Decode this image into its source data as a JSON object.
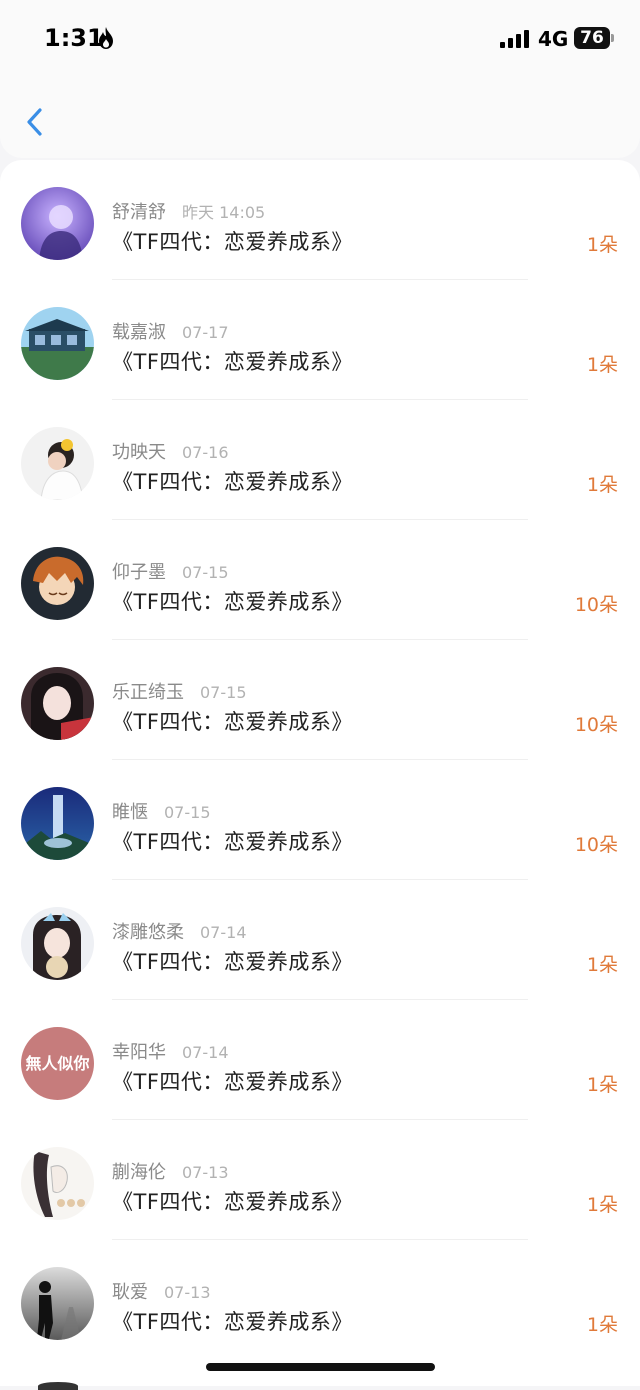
{
  "status": {
    "time": "1:31",
    "network": "4G",
    "battery": "76"
  },
  "nav": {
    "back_icon": "chevron-left-icon"
  },
  "colors": {
    "accent": "#e07a3a",
    "back": "#3a8ee6",
    "username": "#8a8a8a",
    "timestamp": "#b2b2b2"
  },
  "records": [
    {
      "name": "舒清舒",
      "time": "昨天 14:05",
      "title": "《TF四代：恋爱养成系》",
      "amount": "1朵",
      "avatar": "purple-portrait"
    },
    {
      "name": "载嘉淑",
      "time": "07-17",
      "title": "《TF四代：恋爱养成系》",
      "amount": "1朵",
      "avatar": "house-scene"
    },
    {
      "name": "功映天",
      "time": "07-16",
      "title": "《TF四代：恋爱养成系》",
      "amount": "1朵",
      "avatar": "girl-flower"
    },
    {
      "name": "仰子墨",
      "time": "07-15",
      "title": "《TF四代：恋爱养成系》",
      "amount": "10朵",
      "avatar": "anime-boy"
    },
    {
      "name": "乐正绮玉",
      "time": "07-15",
      "title": "《TF四代：恋爱养成系》",
      "amount": "10朵",
      "avatar": "girl-red"
    },
    {
      "name": "睢惬",
      "time": "07-15",
      "title": "《TF四代：恋爱养成系》",
      "amount": "10朵",
      "avatar": "waterfall"
    },
    {
      "name": "漆雕悠柔",
      "time": "07-14",
      "title": "《TF四代：恋爱养成系》",
      "amount": "1朵",
      "avatar": "girl-bow"
    },
    {
      "name": "幸阳华",
      "time": "07-14",
      "title": "《TF四代：恋爱养成系》",
      "amount": "1朵",
      "avatar": "text-badge",
      "avatar_text": "無人似你"
    },
    {
      "name": "蒯海伦",
      "time": "07-13",
      "title": "《TF四代：恋爱养成系》",
      "amount": "1朵",
      "avatar": "sketch-girl"
    },
    {
      "name": "耿爱",
      "time": "07-13",
      "title": "《TF四代：恋爱养成系》",
      "amount": "1朵",
      "avatar": "silhouette"
    }
  ]
}
